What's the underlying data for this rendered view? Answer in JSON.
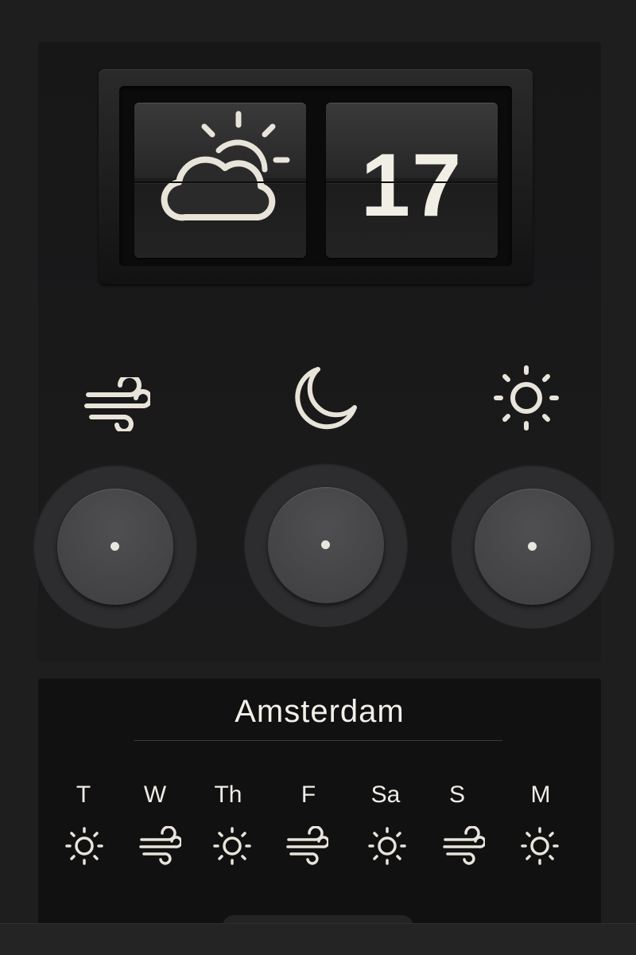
{
  "current": {
    "condition_icon": "partly-cloudy-icon",
    "temperature": "17"
  },
  "modes": [
    {
      "icon": "wind-icon"
    },
    {
      "icon": "moon-icon"
    },
    {
      "icon": "sun-icon"
    }
  ],
  "forecast": {
    "city": "Amsterdam",
    "days": [
      {
        "label": "T",
        "icon": "sun-icon"
      },
      {
        "label": "W",
        "icon": "wind-icon"
      },
      {
        "label": "Th",
        "icon": "sun-icon"
      },
      {
        "label": "F",
        "icon": "wind-icon"
      },
      {
        "label": "Sa",
        "icon": "sun-icon"
      },
      {
        "label": "S",
        "icon": "wind-icon"
      },
      {
        "label": "M",
        "icon": "sun-icon"
      }
    ]
  },
  "colors": {
    "icon": "#e8e4da",
    "background": "#1e1e1f"
  }
}
